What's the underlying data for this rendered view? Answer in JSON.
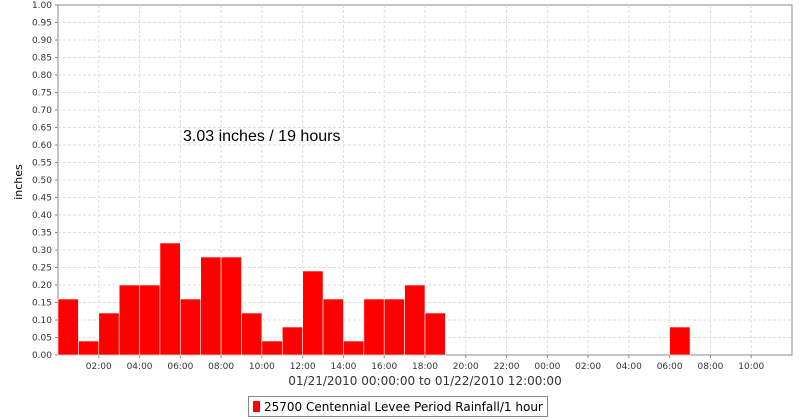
{
  "chart_data": {
    "type": "bar",
    "ylabel": "inches",
    "xlabel": "01/21/2010 00:00:00 to 01/22/2010 12:00:00",
    "annotation": "3.03 inches / 19 hours",
    "ylim": [
      0,
      1.0
    ],
    "yticks": [
      "0.00",
      "0.05",
      "0.10",
      "0.15",
      "0.20",
      "0.25",
      "0.30",
      "0.35",
      "0.40",
      "0.45",
      "0.50",
      "0.55",
      "0.60",
      "0.65",
      "0.70",
      "0.75",
      "0.80",
      "0.85",
      "0.90",
      "0.95",
      "1.00"
    ],
    "xticks": [
      "02:00",
      "04:00",
      "06:00",
      "08:00",
      "10:00",
      "12:00",
      "14:00",
      "16:00",
      "18:00",
      "20:00",
      "22:00",
      "00:00",
      "02:00",
      "04:00",
      "06:00",
      "08:00",
      "10:00"
    ],
    "x_range_hours": [
      0,
      36
    ],
    "grid": true,
    "legend_position": "bottom-center",
    "bar_color": "#ff0000",
    "series": [
      {
        "name": "25700 Centennial Levee Period Rainfall/1 hour",
        "x_hours": [
          0,
          1,
          2,
          3,
          4,
          5,
          6,
          7,
          8,
          9,
          10,
          11,
          12,
          13,
          14,
          15,
          16,
          17,
          18,
          30
        ],
        "values": [
          0.16,
          0.04,
          0.12,
          0.2,
          0.2,
          0.32,
          0.16,
          0.28,
          0.28,
          0.12,
          0.04,
          0.08,
          0.24,
          0.16,
          0.04,
          0.16,
          0.16,
          0.2,
          0.12,
          0.08
        ]
      }
    ]
  }
}
